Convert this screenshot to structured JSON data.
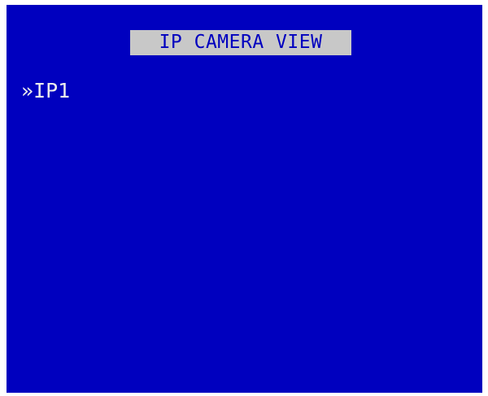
{
  "screen": {
    "title": "IP CAMERA VIEW",
    "background_color": "#0000bf",
    "title_bg_color": "#c8c8c8",
    "text_color": "#ececec"
  },
  "menu": {
    "items": [
      {
        "marker": "»",
        "label": "IP1",
        "selected": true
      }
    ]
  }
}
